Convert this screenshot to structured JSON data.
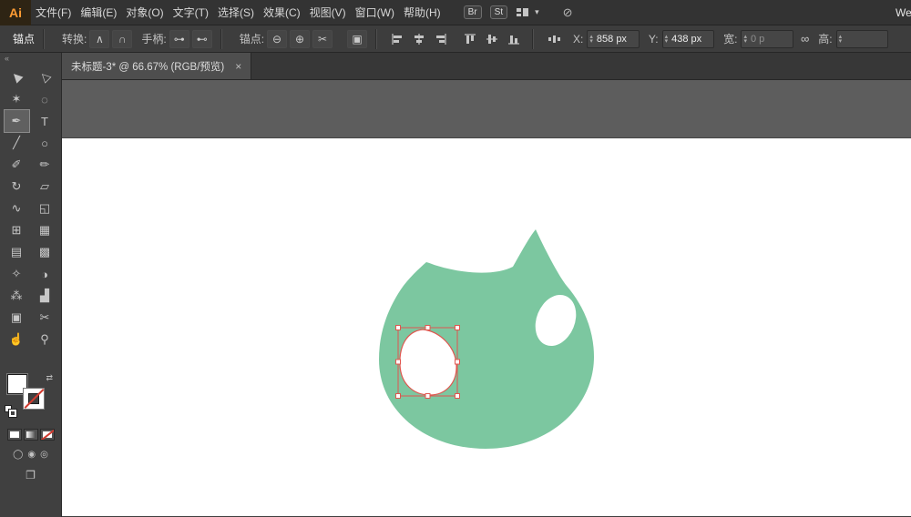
{
  "app": {
    "logo": "Ai",
    "workspace_label": "We"
  },
  "menubar": {
    "items": [
      "文件(F)",
      "编辑(E)",
      "对象(O)",
      "文字(T)",
      "选择(S)",
      "效果(C)",
      "视图(V)",
      "窗口(W)",
      "帮助(H)"
    ],
    "br_badge": "Br",
    "st_badge": "St",
    "workspace_caret": "▾",
    "extra_icon": "⊘"
  },
  "controlbar": {
    "context_label": "锚点",
    "convert_label": "转换:",
    "handles_label": "手柄:",
    "anchors_label": "锚点:",
    "x_label": "X:",
    "x_value": "858 px",
    "y_label": "Y:",
    "y_value": "438 px",
    "w_label": "宽:",
    "w_value": "0 p",
    "h_label": "高:",
    "stepper_up": "▴",
    "stepper_down": "▾",
    "icons": {
      "convert_corner": "∧",
      "convert_smooth": "∩",
      "handles_show": "⊶",
      "handles_hide": "⊷",
      "anchor_remove": "⊖",
      "anchor_add": "⊕",
      "anchor_cut": "✂",
      "isolate": "▣",
      "constrain": "∞"
    }
  },
  "toolpanel": {
    "collapse": "«",
    "swap": "⇄",
    "modes": [
      "◯",
      "◉",
      "◎"
    ],
    "screen_mode": "❐"
  },
  "tools": [
    {
      "name": "selection",
      "glyph": "▶"
    },
    {
      "name": "direct-selection",
      "glyph": "▷"
    },
    {
      "name": "magic-wand",
      "glyph": "✶"
    },
    {
      "name": "lasso",
      "glyph": "◌"
    },
    {
      "name": "pen",
      "glyph": "✒",
      "selected": true
    },
    {
      "name": "type",
      "glyph": "T"
    },
    {
      "name": "line-segment",
      "glyph": "╱"
    },
    {
      "name": "ellipse",
      "glyph": "○"
    },
    {
      "name": "paintbrush",
      "glyph": "✐"
    },
    {
      "name": "pencil",
      "glyph": "✏"
    },
    {
      "name": "rotate",
      "glyph": "↻"
    },
    {
      "name": "scale",
      "glyph": "▱"
    },
    {
      "name": "width",
      "glyph": "∿"
    },
    {
      "name": "free-transform",
      "glyph": "◱"
    },
    {
      "name": "shape-builder",
      "glyph": "⊞"
    },
    {
      "name": "perspective-grid",
      "glyph": "▦"
    },
    {
      "name": "mesh",
      "glyph": "▤"
    },
    {
      "name": "gradient",
      "glyph": "▩"
    },
    {
      "name": "eyedropper",
      "glyph": "✧"
    },
    {
      "name": "blend",
      "glyph": "◑"
    },
    {
      "name": "symbol-sprayer",
      "glyph": "⁂"
    },
    {
      "name": "graph",
      "glyph": "▟"
    },
    {
      "name": "artboard",
      "glyph": "▣"
    },
    {
      "name": "slice",
      "glyph": "✂"
    },
    {
      "name": "hand",
      "glyph": "☝"
    },
    {
      "name": "zoom",
      "glyph": "⚲"
    }
  ],
  "document": {
    "tab_title": "未标题-3* @ 66.67% (RGB/预览)",
    "close": "×"
  },
  "colors": {
    "artwork_green": "#7cc7a0",
    "selection_red": "#e0564f",
    "logo_orange": "#ff9c33"
  }
}
